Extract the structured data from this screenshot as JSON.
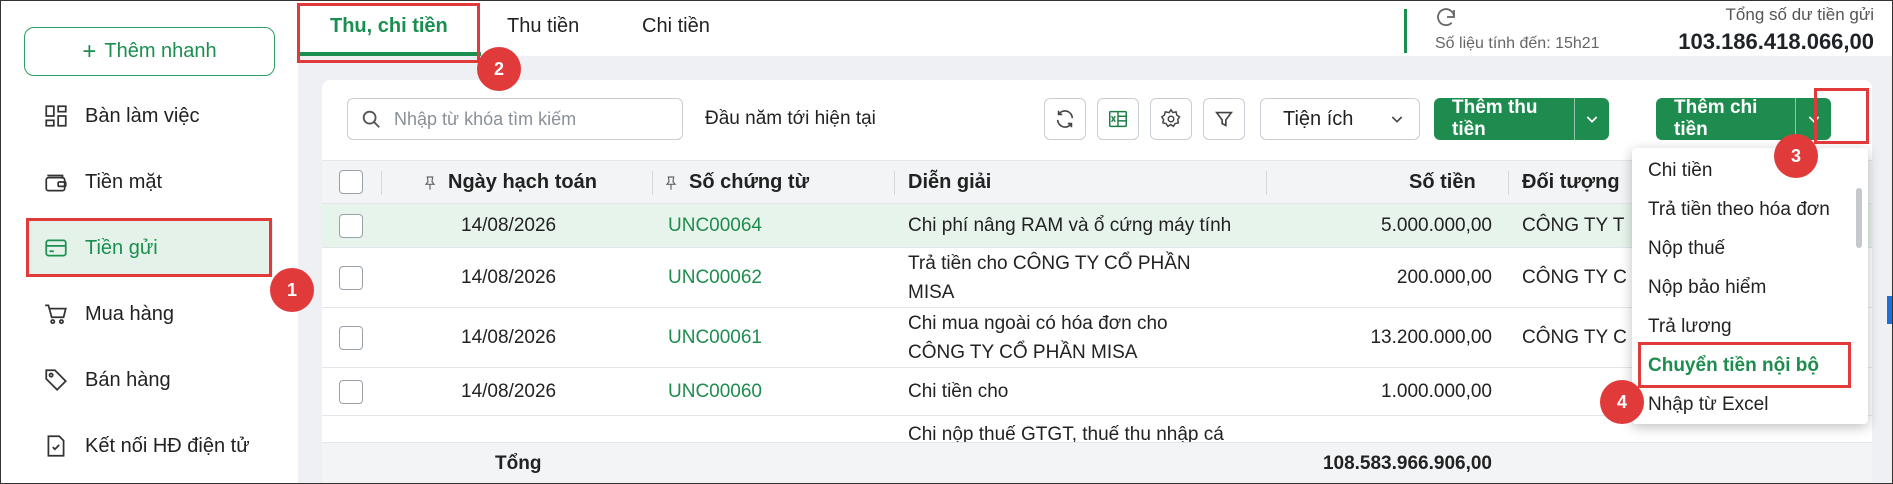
{
  "sidebar": {
    "quick_add": "Thêm nhanh",
    "items": [
      {
        "label": "Bàn làm việc",
        "icon": "dashboard-icon"
      },
      {
        "label": "Tiền mặt",
        "icon": "wallet-icon"
      },
      {
        "label": "Tiền gửi",
        "icon": "bank-card-icon"
      },
      {
        "label": "Mua hàng",
        "icon": "cart-icon"
      },
      {
        "label": "Bán hàng",
        "icon": "tag-icon"
      },
      {
        "label": "Kết nối HĐ điện tử",
        "icon": "invoice-check-icon"
      }
    ],
    "active_index": 2
  },
  "tabs": [
    {
      "label": "Thu, chi tiền"
    },
    {
      "label": "Thu tiền"
    },
    {
      "label": "Chi tiền"
    }
  ],
  "balance": {
    "as_of": "Số liệu tính đến: 15h21",
    "label": "Tổng số dư tiền gửi",
    "value": "103.186.418.066,00"
  },
  "toolbar": {
    "search_placeholder": "Nhập từ khóa tìm kiếm",
    "period": "Đầu năm tới hiện tại",
    "utilities": "Tiện ích",
    "add_receipt": "Thêm thu tiền",
    "add_payment": "Thêm chi tiền"
  },
  "table": {
    "headers": {
      "date": "Ngày hạch toán",
      "doc_no": "Số chứng từ",
      "description": "Diễn giải",
      "amount": "Số tiền",
      "party": "Đối tượng"
    },
    "rows": [
      {
        "date": "14/08/2026",
        "doc_no": "UNC00064",
        "desc1": "Chi phí nâng RAM và ổ cứng máy tính",
        "desc2": "",
        "amount": "5.000.000,00",
        "party": "CÔNG TY T"
      },
      {
        "date": "14/08/2026",
        "doc_no": "UNC00062",
        "desc1": "Trả tiền cho CÔNG TY CỔ PHẦN",
        "desc2": "MISA",
        "amount": "200.000,00",
        "party": "CÔNG TY C"
      },
      {
        "date": "14/08/2026",
        "doc_no": "UNC00061",
        "desc1": "Chi mua ngoài có hóa đơn cho",
        "desc2": "CÔNG TY CỔ PHẦN MISA",
        "amount": "13.200.000,00",
        "party": "CÔNG TY C"
      },
      {
        "date": "14/08/2026",
        "doc_no": "UNC00060",
        "desc1": "Chi tiền cho",
        "desc2": "",
        "amount": "1.000.000,00",
        "party": ""
      },
      {
        "date": "",
        "doc_no": "",
        "desc1": "Chi nộp thuế GTGT, thuế thu nhập cá",
        "desc2": "",
        "amount": "",
        "party": ""
      }
    ],
    "total_label": "Tổng",
    "total_amount": "108.583.966.906,00"
  },
  "menu": {
    "items": [
      "Chi tiền",
      "Trả tiền theo hóa đơn",
      "Nộp thuế",
      "Nộp bảo hiểm",
      "Trả lương",
      "Chuyển tiền nội bộ",
      "Nhập từ Excel"
    ],
    "highlighted_index": 5
  },
  "annotations": [
    "1",
    "2",
    "3",
    "4"
  ],
  "colors": {
    "accent": "#1e8c4e",
    "highlight": "#e03a3a",
    "active_bg": "#e5f2ea"
  }
}
